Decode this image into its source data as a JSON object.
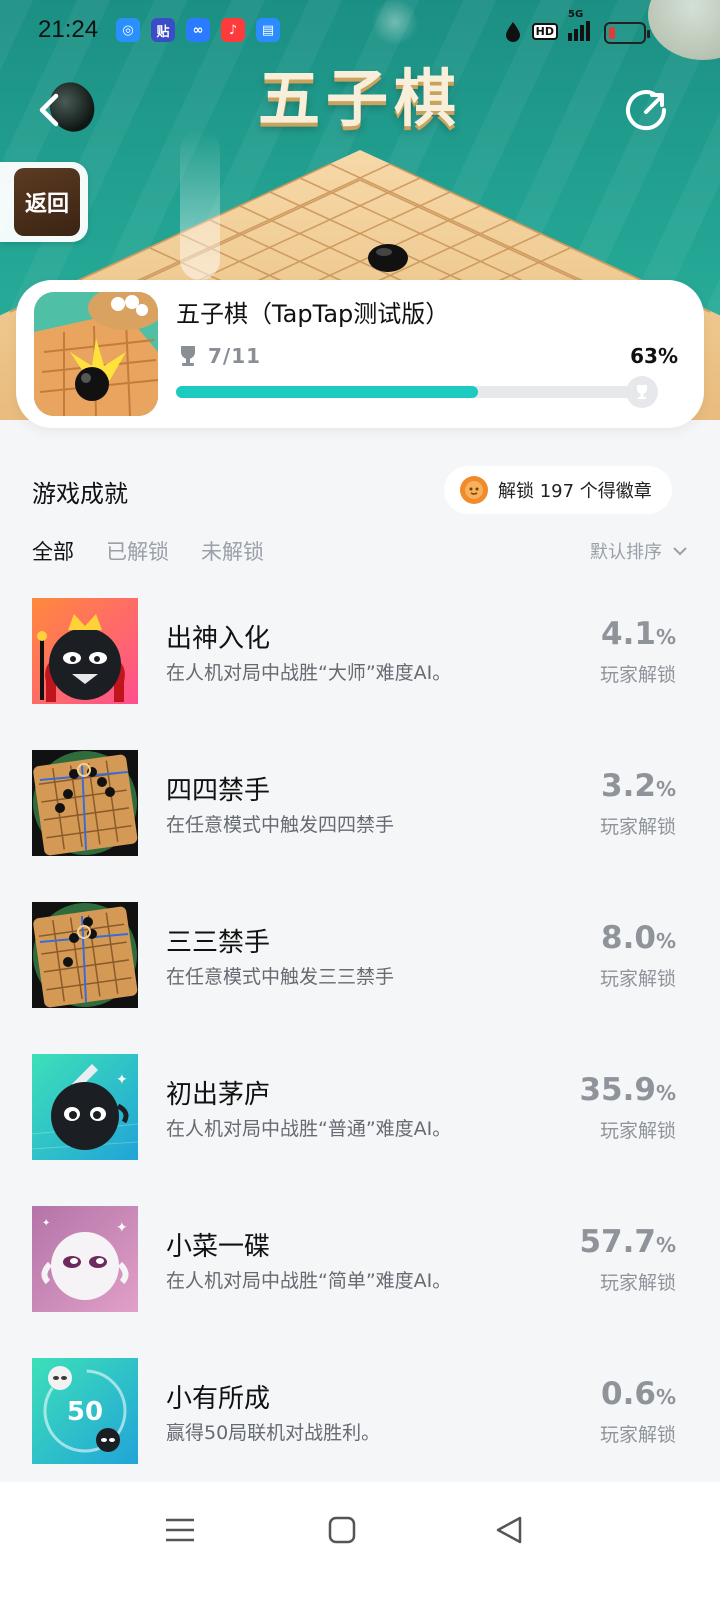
{
  "status_bar": {
    "time": "21:24",
    "apps": [
      {
        "name": "browser-app-icon",
        "color": "#2a8fff",
        "glyph": "◎"
      },
      {
        "name": "tieba-app-icon",
        "color": "#3b4cc8",
        "glyph": "贴"
      },
      {
        "name": "baidu-netdisk-app-icon",
        "color": "#2a7bff",
        "glyph": "∞"
      },
      {
        "name": "music-app-icon",
        "color": "#ff3a3a",
        "glyph": "♪"
      },
      {
        "name": "files-app-icon",
        "color": "#2b8cff",
        "glyph": "▤"
      }
    ],
    "network": "5G",
    "hd": "HD",
    "battery_color": "#e53935"
  },
  "hero": {
    "title": "五子棋",
    "back_label": "返回"
  },
  "game": {
    "name": "五子棋（TapTap测试版）",
    "progress": "7/11",
    "percent": "63%",
    "progress_fraction": 0.63
  },
  "achievements_section": {
    "title": "游戏成就",
    "badge_text": "解锁 197 个得徽章",
    "tabs": [
      "全部",
      "已解锁",
      "未解锁"
    ],
    "active_tab": 0,
    "sort_label": "默认排序"
  },
  "achievements": [
    {
      "name": "出神入化",
      "desc": "在人机对局中战胜“大师”难度AI。",
      "rate": "4.1",
      "unit": "%",
      "rate_label": "玩家解锁",
      "icon": "king-stone-icon"
    },
    {
      "name": "四四禁手",
      "desc": "在任意模式中触发四四禁手",
      "rate": "3.2",
      "unit": "%",
      "rate_label": "玩家解锁",
      "icon": "double-four-board-icon"
    },
    {
      "name": "三三禁手",
      "desc": "在任意模式中触发三三禁手",
      "rate": "8.0",
      "unit": "%",
      "rate_label": "玩家解锁",
      "icon": "double-three-board-icon"
    },
    {
      "name": "初出茅庐",
      "desc": "在人机对局中战胜“普通”难度AI。",
      "rate": "35.9",
      "unit": "%",
      "rate_label": "玩家解锁",
      "icon": "ninja-stone-icon"
    },
    {
      "name": "小菜一碟",
      "desc": "在人机对局中战胜“简单”难度AI。",
      "rate": "57.7",
      "unit": "%",
      "rate_label": "玩家解锁",
      "icon": "white-stone-icon"
    },
    {
      "name": "小有所成",
      "desc": "赢得50局联机对战胜利。",
      "rate": "0.6",
      "unit": "%",
      "rate_label": "玩家解锁",
      "icon": "fifty-wins-icon"
    }
  ],
  "colors": {
    "accent": "#1ccbc0",
    "hero_teal": "#23a493",
    "badge_orange": "#f08a2a"
  }
}
